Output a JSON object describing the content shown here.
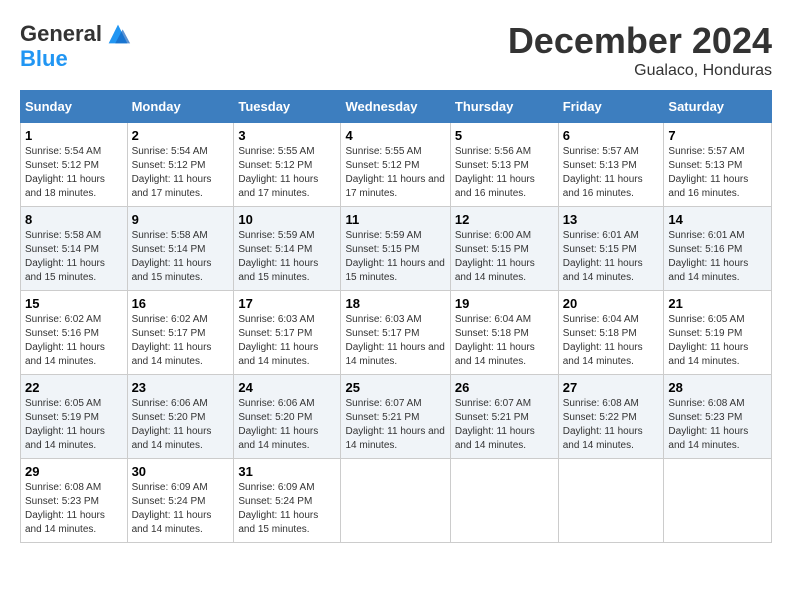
{
  "app": {
    "logo_general": "General",
    "logo_blue": "Blue"
  },
  "header": {
    "month": "December 2024",
    "location": "Gualaco, Honduras"
  },
  "columns": [
    "Sunday",
    "Monday",
    "Tuesday",
    "Wednesday",
    "Thursday",
    "Friday",
    "Saturday"
  ],
  "weeks": [
    [
      {
        "day": "1",
        "sunrise": "5:54 AM",
        "sunset": "5:12 PM",
        "daylight": "11 hours and 18 minutes."
      },
      {
        "day": "2",
        "sunrise": "5:54 AM",
        "sunset": "5:12 PM",
        "daylight": "11 hours and 17 minutes."
      },
      {
        "day": "3",
        "sunrise": "5:55 AM",
        "sunset": "5:12 PM",
        "daylight": "11 hours and 17 minutes."
      },
      {
        "day": "4",
        "sunrise": "5:55 AM",
        "sunset": "5:12 PM",
        "daylight": "11 hours and 17 minutes."
      },
      {
        "day": "5",
        "sunrise": "5:56 AM",
        "sunset": "5:13 PM",
        "daylight": "11 hours and 16 minutes."
      },
      {
        "day": "6",
        "sunrise": "5:57 AM",
        "sunset": "5:13 PM",
        "daylight": "11 hours and 16 minutes."
      },
      {
        "day": "7",
        "sunrise": "5:57 AM",
        "sunset": "5:13 PM",
        "daylight": "11 hours and 16 minutes."
      }
    ],
    [
      {
        "day": "8",
        "sunrise": "5:58 AM",
        "sunset": "5:14 PM",
        "daylight": "11 hours and 15 minutes."
      },
      {
        "day": "9",
        "sunrise": "5:58 AM",
        "sunset": "5:14 PM",
        "daylight": "11 hours and 15 minutes."
      },
      {
        "day": "10",
        "sunrise": "5:59 AM",
        "sunset": "5:14 PM",
        "daylight": "11 hours and 15 minutes."
      },
      {
        "day": "11",
        "sunrise": "5:59 AM",
        "sunset": "5:15 PM",
        "daylight": "11 hours and 15 minutes."
      },
      {
        "day": "12",
        "sunrise": "6:00 AM",
        "sunset": "5:15 PM",
        "daylight": "11 hours and 14 minutes."
      },
      {
        "day": "13",
        "sunrise": "6:01 AM",
        "sunset": "5:15 PM",
        "daylight": "11 hours and 14 minutes."
      },
      {
        "day": "14",
        "sunrise": "6:01 AM",
        "sunset": "5:16 PM",
        "daylight": "11 hours and 14 minutes."
      }
    ],
    [
      {
        "day": "15",
        "sunrise": "6:02 AM",
        "sunset": "5:16 PM",
        "daylight": "11 hours and 14 minutes."
      },
      {
        "day": "16",
        "sunrise": "6:02 AM",
        "sunset": "5:17 PM",
        "daylight": "11 hours and 14 minutes."
      },
      {
        "day": "17",
        "sunrise": "6:03 AM",
        "sunset": "5:17 PM",
        "daylight": "11 hours and 14 minutes."
      },
      {
        "day": "18",
        "sunrise": "6:03 AM",
        "sunset": "5:17 PM",
        "daylight": "11 hours and 14 minutes."
      },
      {
        "day": "19",
        "sunrise": "6:04 AM",
        "sunset": "5:18 PM",
        "daylight": "11 hours and 14 minutes."
      },
      {
        "day": "20",
        "sunrise": "6:04 AM",
        "sunset": "5:18 PM",
        "daylight": "11 hours and 14 minutes."
      },
      {
        "day": "21",
        "sunrise": "6:05 AM",
        "sunset": "5:19 PM",
        "daylight": "11 hours and 14 minutes."
      }
    ],
    [
      {
        "day": "22",
        "sunrise": "6:05 AM",
        "sunset": "5:19 PM",
        "daylight": "11 hours and 14 minutes."
      },
      {
        "day": "23",
        "sunrise": "6:06 AM",
        "sunset": "5:20 PM",
        "daylight": "11 hours and 14 minutes."
      },
      {
        "day": "24",
        "sunrise": "6:06 AM",
        "sunset": "5:20 PM",
        "daylight": "11 hours and 14 minutes."
      },
      {
        "day": "25",
        "sunrise": "6:07 AM",
        "sunset": "5:21 PM",
        "daylight": "11 hours and 14 minutes."
      },
      {
        "day": "26",
        "sunrise": "6:07 AM",
        "sunset": "5:21 PM",
        "daylight": "11 hours and 14 minutes."
      },
      {
        "day": "27",
        "sunrise": "6:08 AM",
        "sunset": "5:22 PM",
        "daylight": "11 hours and 14 minutes."
      },
      {
        "day": "28",
        "sunrise": "6:08 AM",
        "sunset": "5:23 PM",
        "daylight": "11 hours and 14 minutes."
      }
    ],
    [
      {
        "day": "29",
        "sunrise": "6:08 AM",
        "sunset": "5:23 PM",
        "daylight": "11 hours and 14 minutes."
      },
      {
        "day": "30",
        "sunrise": "6:09 AM",
        "sunset": "5:24 PM",
        "daylight": "11 hours and 14 minutes."
      },
      {
        "day": "31",
        "sunrise": "6:09 AM",
        "sunset": "5:24 PM",
        "daylight": "11 hours and 15 minutes."
      },
      null,
      null,
      null,
      null
    ]
  ],
  "labels": {
    "sunrise": "Sunrise:",
    "sunset": "Sunset:",
    "daylight": "Daylight:"
  }
}
